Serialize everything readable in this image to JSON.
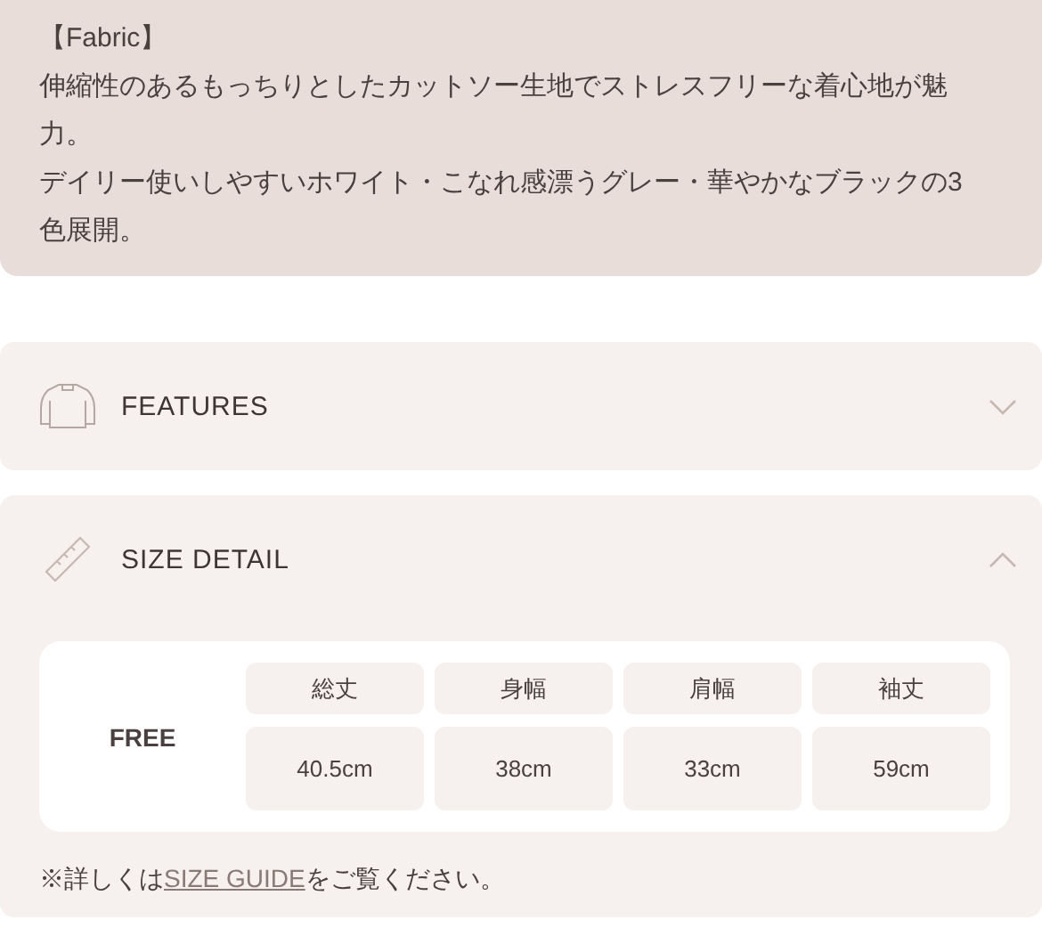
{
  "description": {
    "heading": "【Fabric】",
    "paragraphs": [
      "伸縮性のあるもっちりとしたカットソー生地でストレスフリーな着心地が魅力。",
      "デイリー使いしやすいホワイト・こなれ感漂うグレー・華やかなブラックの3色展開。"
    ]
  },
  "sections": [
    {
      "kind": "features",
      "title": "FEATURES",
      "expanded": false
    },
    {
      "kind": "size",
      "title": "SIZE DETAIL",
      "expanded": true,
      "size_table": {
        "size": "FREE",
        "columns": [
          {
            "label": "総丈",
            "value": "40.5cm"
          },
          {
            "label": "身幅",
            "value": "38cm"
          },
          {
            "label": "肩幅",
            "value": "33cm"
          },
          {
            "label": "袖丈",
            "value": "59cm"
          }
        ]
      },
      "note": {
        "before": "※詳しくは",
        "link": "SIZE GUIDE",
        "after": "をご覧ください。"
      }
    }
  ]
}
